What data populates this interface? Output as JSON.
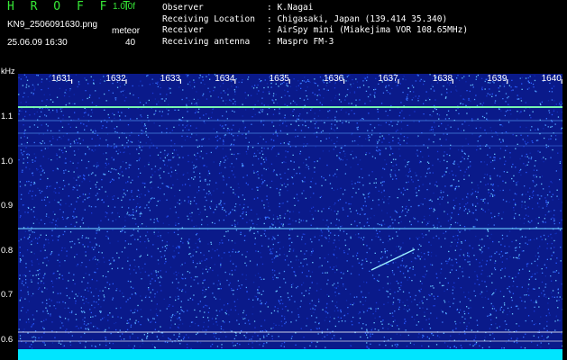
{
  "header": {
    "brand": "H R O F F T",
    "version": "1.0.0f",
    "filename": "KN9_2506091630.png",
    "meteor_label": "meteor",
    "datetime": "25.06.09 16:30",
    "meteor_count": "40"
  },
  "info": {
    "observer_label": "Observer",
    "observer_value": ": K.Nagai",
    "location_label": "Receiving Location",
    "location_value": ": Chigasaki, Japan (139.414 35.340)",
    "receiver_label": "Receiver",
    "receiver_value": ": AirSpy mini (Miakejima VOR 108.65MHz)",
    "antenna_label": "Receiving antenna",
    "antenna_value": ": Maspro FM-3"
  },
  "axes": {
    "y_unit": "kHz",
    "x_ticks": [
      "1631",
      "1632",
      "1633",
      "1634",
      "1635",
      "1636",
      "1637",
      "1638",
      "1639",
      "1640"
    ],
    "y_ticks": [
      "1.1",
      "1.0",
      "0.9",
      "0.8",
      "0.7",
      "0.6"
    ]
  },
  "colors": {
    "background": "#000000",
    "noise_base": "#0a1a8a",
    "carrier": "#7cffb0",
    "meteor": "#9cf0ff",
    "baseband": "#00e5ff",
    "brand": "#36e836"
  }
}
